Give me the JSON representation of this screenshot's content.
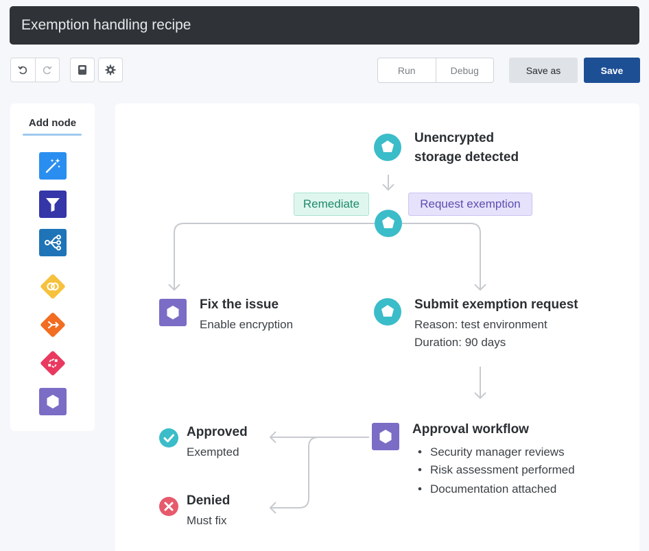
{
  "header": {
    "title": "Exemption handling recipe"
  },
  "toolbar": {
    "undo_icon": "undo-icon",
    "redo_icon": "redo-icon",
    "docs_icon": "book-icon",
    "settings_icon": "gear-icon",
    "run_label": "Run",
    "debug_label": "Debug",
    "save_as_label": "Save as",
    "save_label": "Save"
  },
  "sidebar": {
    "title": "Add node",
    "nodes": [
      {
        "icon": "magic-wand-icon",
        "color": "#2a8ef0"
      },
      {
        "icon": "filter-icon",
        "color": "#3536a8"
      },
      {
        "icon": "branch-icon",
        "color": "#1e74b7"
      },
      {
        "icon": "rings-icon",
        "color": "#f6c13c"
      },
      {
        "icon": "merge-arrow-icon",
        "color": "#f26c22"
      },
      {
        "icon": "shuffle-icon",
        "color": "#e9395f"
      },
      {
        "icon": "hexagon-icon",
        "color": "#7b6cc6"
      }
    ]
  },
  "flow": {
    "trigger": {
      "title_line1": "Unencrypted",
      "title_line2": "storage detected"
    },
    "branch_left_label": "Remediate",
    "branch_right_label": "Request exemption",
    "fix": {
      "title": "Fix the issue",
      "subtitle": "Enable encryption"
    },
    "submit": {
      "title": "Submit exemption request",
      "line1": "Reason: test environment",
      "line2": "Duration: 90 days"
    },
    "approval": {
      "title": "Approval workflow",
      "bullets": [
        "Security manager reviews",
        "Risk assessment performed",
        "Documentation attached"
      ]
    },
    "approved": {
      "title": "Approved",
      "subtitle": "Exempted"
    },
    "denied": {
      "title": "Denied",
      "subtitle": "Must fix"
    }
  },
  "colors": {
    "teal": "#3bbcc9",
    "purple": "#7b6cc6",
    "green_check": "#3bbcc9",
    "red_x": "#e65a6c",
    "remediate_bg": "#dff6ee",
    "remediate_text": "#1f8a6b",
    "exemption_bg": "#e6e2fb",
    "exemption_text": "#5b4fb0"
  }
}
